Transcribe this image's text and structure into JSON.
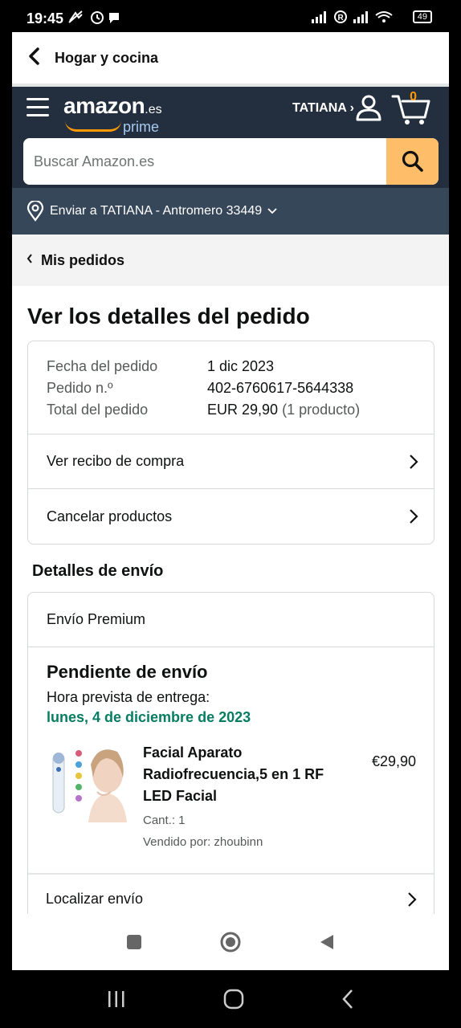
{
  "status_bar": {
    "time": "19:45",
    "battery": "49"
  },
  "topbar": {
    "title": "Hogar y cocina"
  },
  "header": {
    "logo_word": "amazon",
    "logo_suffix": ".es",
    "logo_prime": "prime",
    "account_label": "TATIANA ›",
    "cart_count": "0",
    "search_placeholder": "Buscar Amazon.es"
  },
  "deliver_to": "Enviar a TATIANA - Antromero 33449",
  "breadcrumb": "Mis pedidos",
  "page_title": "Ver los detalles del pedido",
  "order_summary": {
    "rows": [
      {
        "label": "Fecha del pedido",
        "value": "1 dic 2023"
      },
      {
        "label": "Pedido n.º",
        "value": "402-6760617-5644338"
      },
      {
        "label": "Total del pedido",
        "value": "EUR 29,90",
        "note": "(1 producto)"
      }
    ],
    "links": [
      "Ver recibo de compra",
      "Cancelar productos"
    ]
  },
  "shipping": {
    "section_title": "Detalles de envío",
    "shipping_type": "Envío Premium",
    "status": "Pendiente de envío",
    "eta_label": "Hora prevista de entrega:",
    "eta_date": "lunes, 4 de diciembre de 2023",
    "item": {
      "name": "Facial Aparato Radiofrecuencia,5 en 1 RF LED Facial",
      "price": "€29,90",
      "quantity": "Cant.: 1",
      "seller": "Vendido por: zhoubinn"
    },
    "track_link": "Localizar envío"
  },
  "colors": {
    "header_bg": "#232f3e",
    "deliver_bg": "#37475a",
    "search_button": "#febd69",
    "eta_green": "#067d62",
    "cart_orange": "#ff9900"
  }
}
